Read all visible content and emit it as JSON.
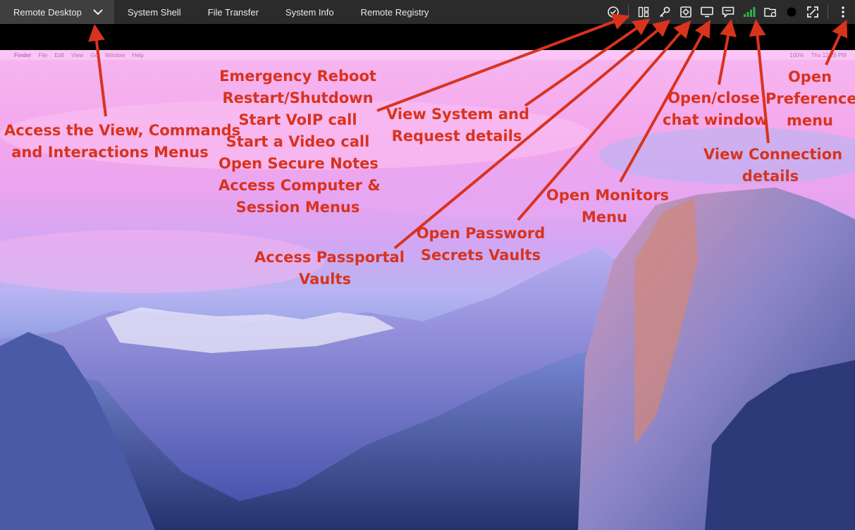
{
  "toolbar": {
    "tabs": [
      {
        "label": "Remote Desktop",
        "active": true
      },
      {
        "label": "System Shell"
      },
      {
        "label": "File Transfer"
      },
      {
        "label": "System Info"
      },
      {
        "label": "Remote Registry"
      }
    ],
    "tools": [
      "power-check-icon",
      "view-panels-icon",
      "key-icon",
      "vault-icon",
      "monitor-icon",
      "chat-icon",
      "signal-bars-icon",
      "folder-settings-icon",
      "record-dot-icon",
      "fullscreen-icon",
      "more-vertical-icon"
    ]
  },
  "mac_menubar": {
    "apple": "",
    "items": [
      "Finder",
      "File",
      "Edit",
      "View",
      "Go",
      "Window",
      "Help"
    ],
    "status": "100%",
    "clock": "Thu 12:26 PM"
  },
  "annotations": {
    "view_menus": [
      "Access the View, Commands",
      "and Interactions Menus"
    ],
    "emergency": [
      "Emergency Reboot",
      "Restart/Shutdown",
      "Start VoIP call",
      "Start a Video call",
      "Open Secure Notes",
      "Access Computer &",
      "Session Menus"
    ],
    "system_details": [
      "View System and",
      "Request details"
    ],
    "passportal": [
      "Access Passportal",
      "Vaults"
    ],
    "password_secrets": [
      "Open Password",
      "Secrets Vaults"
    ],
    "monitors": [
      "Open Monitors",
      "Menu"
    ],
    "chat": [
      "Open/close",
      "chat window"
    ],
    "connection": [
      "View Connection",
      "details"
    ],
    "preferences": [
      "Open",
      "Preferences",
      "menu"
    ]
  },
  "colors": {
    "toolbar_bg": "#2b2b2b",
    "active_tab_bg": "#3f3f3f",
    "annotation_red": "#d8331d",
    "signal_green": "#2bb24c"
  }
}
